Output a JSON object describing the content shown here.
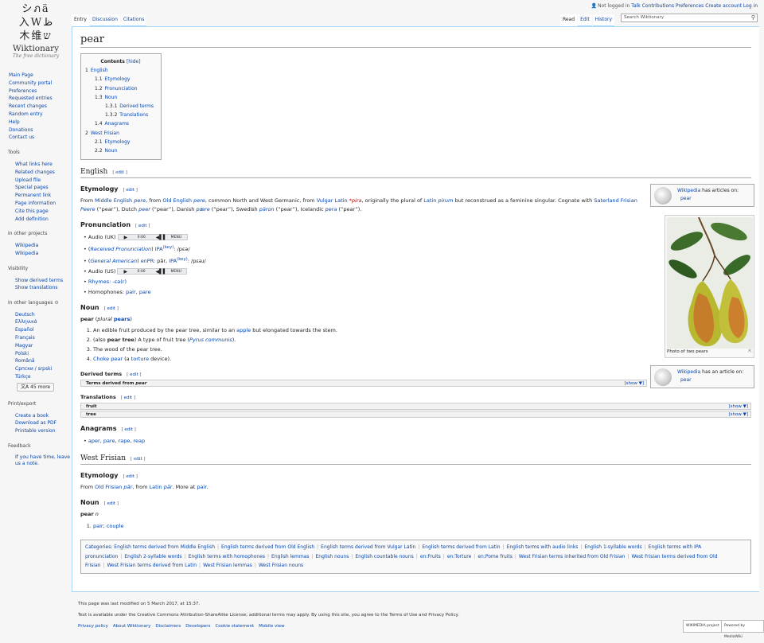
{
  "logo": {
    "glyphs_row1": "シ",
    "glyphs_row1b": "ภ",
    "glyphs_row1c": "ä",
    "glyphs_row2": "入",
    "glyphs_row2b": "W",
    "glyphs_row2c": "ظ",
    "glyphs_row3": "木",
    "glyphs_row3b": "维",
    "glyphs_row3c": "ש",
    "name": "Wiktionary",
    "tagline": "The free dictionary"
  },
  "sidebar": {
    "nav": [
      "Main Page",
      "Community portal",
      "Preferences",
      "Requested entries",
      "Recent changes",
      "Random entry",
      "Help",
      "Donations",
      "Contact us"
    ],
    "tools_heading": "Tools",
    "tools": [
      "What links here",
      "Related changes",
      "Upload file",
      "Special pages",
      "Permanent link",
      "Page information",
      "Cite this page",
      "Add definition"
    ],
    "projects_heading": "In other projects",
    "projects": [
      "Wikipedia",
      "Wikipedia"
    ],
    "visibility_heading": "Visibility",
    "visibility": [
      "Show derived terms",
      "Show translations"
    ],
    "languages_heading": "In other languages",
    "languages": [
      "Deutsch",
      "Ελληνικά",
      "Español",
      "Français",
      "Magyar",
      "Polski",
      "Română",
      "Српски / srpski",
      "Türkçe"
    ],
    "languages_more": "45 more",
    "print_heading": "Print/export",
    "print": [
      "Create a book",
      "Download as PDF",
      "Printable version"
    ],
    "feedback_heading": "Feedback",
    "feedback": [
      "If you have time, leave us a note."
    ]
  },
  "personal": {
    "not_logged": "Not logged in",
    "talk": "Talk",
    "contributions": "Contributions",
    "preferences": "Preferences",
    "create": "Create account",
    "login": "Log in"
  },
  "tabs_left": [
    "Entry",
    "Discussion",
    "Citations"
  ],
  "tabs_right": [
    "Read",
    "Edit",
    "History"
  ],
  "search": {
    "placeholder": "Search Wiktionary"
  },
  "page_title": "pear",
  "toc": {
    "title": "Contents",
    "hide": "[hide]",
    "items": [
      {
        "num": "1",
        "label": "English",
        "lvl": 1
      },
      {
        "num": "1.1",
        "label": "Etymology",
        "lvl": 2
      },
      {
        "num": "1.2",
        "label": "Pronunciation",
        "lvl": 2
      },
      {
        "num": "1.3",
        "label": "Noun",
        "lvl": 2
      },
      {
        "num": "1.3.1",
        "label": "Derived terms",
        "lvl": 3
      },
      {
        "num": "1.3.2",
        "label": "Translations",
        "lvl": 3
      },
      {
        "num": "1.4",
        "label": "Anagrams",
        "lvl": 2
      },
      {
        "num": "2",
        "label": "West Frisian",
        "lvl": 1
      },
      {
        "num": "2.1",
        "label": "Etymology",
        "lvl": 2
      },
      {
        "num": "2.2",
        "label": "Noun",
        "lvl": 2
      }
    ]
  },
  "edit_label": "edit",
  "english": {
    "heading": "English",
    "etymology_h": "Etymology",
    "etym_1": "From ",
    "etym_me": "Middle English",
    "etym_pere": "pere",
    "etym_2": ", from ",
    "etym_oe": "Old English",
    "etym_pere2": "pere",
    "etym_3": ", common North and West Germanic, from ",
    "etym_vl": "Vulgar Latin",
    "etym_pira": "*pira",
    "etym_4": ", originally the plural of ",
    "etym_la": "Latin",
    "etym_pirum": "pirum",
    "etym_5": " but reconstrued as a feminine singular. Cognate with",
    "etym_sf": "Saterland Frisian",
    "etym_peere": "Peere",
    "etym_6": " (“pear”), Dutch ",
    "etym_dutch": "peer",
    "etym_7": " (“pear”), Danish ",
    "etym_danish": "pære",
    "etym_8": " (“pear”), Swedish ",
    "etym_swedish": "päron",
    "etym_9": " (“pear”), Icelandic ",
    "etym_icelandic": "pera",
    "etym_10": " (“pear”).",
    "pron_h": "Pronunciation",
    "audio_uk": "Audio (UK)",
    "audio_us": "Audio (US)",
    "player": {
      "play": "▶",
      "time": "0:00",
      "volume": "◀▌▌",
      "menu": "MENU"
    },
    "rp": "Received Pronunciation",
    "ipa": "IPA",
    "key": "(key)",
    "ipa_rp": ": /pɛə/",
    "ga": "General American",
    "enpr": "enPR",
    "enpr_val": ": pâr, ",
    "ipa_ga": ": /pɛəɹ/",
    "rhymes_label": "Rhymes: ",
    "rhymes": "-ɛə(r)",
    "homophones_label": "Homophones: ",
    "homo1": "pair",
    "homo2": "pare",
    "noun_h": "Noun",
    "headword": "pear",
    "plural_label": "plural",
    "plural": "pears",
    "defs": [
      {
        "pre": "An edible fruit produced by the pear tree, similar to an ",
        "link": "apple",
        "post": " but elongated towards the stem."
      },
      {
        "pre": "(also ",
        "bold": "pear tree",
        "mid": ") A type of fruit tree (",
        "link": "Pyrus communis",
        "post": ")."
      },
      {
        "pre": "The wood of the pear tree.",
        "link": "",
        "post": ""
      },
      {
        "pre": "",
        "link": "Choke pear",
        "mid": " (a ",
        "link2": "torture",
        "post": " device)."
      }
    ],
    "derived_h": "Derived terms",
    "derived_box": "Terms derived from ",
    "derived_word": "pear",
    "show": "[show ▼]",
    "trans_h": "Translations",
    "trans": [
      "fruit",
      "tree"
    ],
    "anagrams_h": "Anagrams",
    "anagrams": [
      "aper",
      "pare",
      "rape",
      "reap"
    ]
  },
  "westfrisian": {
    "heading": "West Frisian",
    "etymology_h": "Etymology",
    "etym_1": "From ",
    "etym_ofr": "Old Frisian",
    "etym_par": "pār",
    "etym_2": ", from ",
    "etym_la": "Latin",
    "etym_par2": "pār",
    "etym_3": ". More at ",
    "etym_pair": "pair",
    "noun_h": "Noun",
    "headword": "pear",
    "gender": "n",
    "defs": [
      {
        "a": "pair",
        "b": "couple"
      }
    ]
  },
  "sister": {
    "wp1_link": "Wikipedia",
    "wp1_text": " has articles on:",
    "wp1_item": "pear",
    "wp2_link": "Wikipedia",
    "wp2_text": " has an article on:",
    "wp2_item": "pear"
  },
  "thumb_caption": "Photo of two pears",
  "categories": {
    "label": "Categories",
    "items": [
      "English terms derived from Middle English",
      "English terms derived from Old English",
      "English terms derived from Vulgar Latin",
      "English terms derived from Latin",
      "English terms with audio links",
      "English 1-syllable words",
      "English terms with IPA pronunciation",
      "English 2-syllable words",
      "English terms with homophones",
      "English lemmas",
      "English nouns",
      "English countable nouns",
      "en:Fruits",
      "en:Torture",
      "en:Pome fruits",
      "West Frisian terms inherited from Old Frisian",
      "West Frisian terms derived from Old Frisian",
      "West Frisian terms derived from Latin",
      "West Frisian lemmas",
      "West Frisian nouns"
    ]
  },
  "footer": {
    "modified": "This page was last modified on 5 March 2017, at 15:37.",
    "license": "Text is available under the Creative Commons Attribution-ShareAlike License; additional terms may apply. By using this site, you agree to the Terms of Use and Privacy Policy.",
    "links": [
      "Privacy policy",
      "About Wiktionary",
      "Disclaimers",
      "Developers",
      "Cookie statement",
      "Mobile view"
    ],
    "badge1": "WIKIMEDIA project",
    "badge2": "Powered by MediaWiki"
  }
}
